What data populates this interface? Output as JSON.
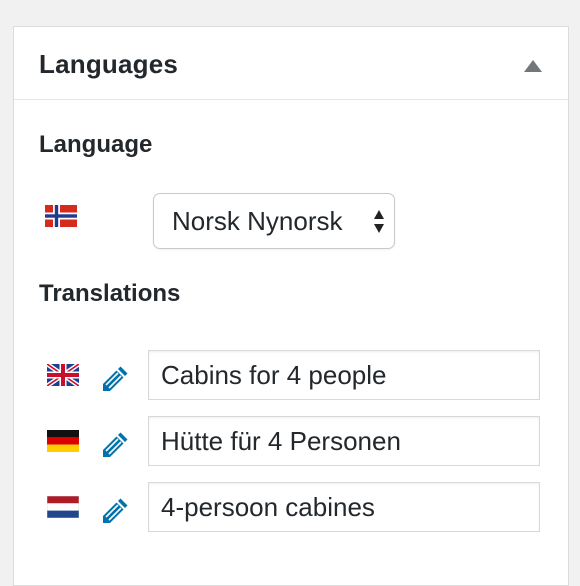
{
  "panel": {
    "title": "Languages",
    "toggle_icon": "triangle-up-icon"
  },
  "language": {
    "label": "Language",
    "current_flag": "norway-flag-icon",
    "select_value": "Norsk Nynorsk"
  },
  "translations": {
    "label": "Translations",
    "items": [
      {
        "flag": "uk-flag-icon",
        "edit_icon": "pencil-icon",
        "value": "Cabins for 4 people"
      },
      {
        "flag": "germany-flag-icon",
        "edit_icon": "pencil-icon",
        "value": "Hütte für 4 Personen"
      },
      {
        "flag": "netherlands-flag-icon",
        "edit_icon": "pencil-icon",
        "value": "4-persoon cabines"
      }
    ]
  },
  "colors": {
    "accent": "#0073aa",
    "text": "#23282d",
    "toggle": "#72777c"
  }
}
